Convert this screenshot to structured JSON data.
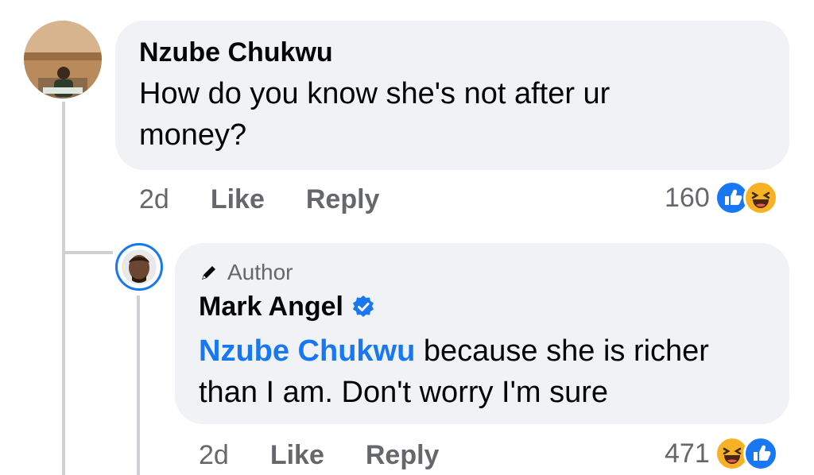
{
  "comment": {
    "author": "Nzube Chukwu",
    "text_line1": "How do you know she's not after ur",
    "text_line2": "money?",
    "time": "2d",
    "like_label": "Like",
    "reply_label": "Reply",
    "reaction_count": "160",
    "reactions": [
      "like-icon",
      "haha-icon"
    ]
  },
  "reply": {
    "badge": "Author",
    "author": "Mark Angel",
    "verified": true,
    "mention": "Nzube Chukwu",
    "text_line1_rest": " because she is richer",
    "text_line2": "than I am. Don't worry I'm sure",
    "time": "2d",
    "like_label": "Like",
    "reply_label": "Reply",
    "reaction_count": "471",
    "reactions": [
      "haha-icon",
      "like-icon"
    ]
  },
  "colors": {
    "accent": "#1877f2",
    "bubble": "#f0f2f5",
    "secondary_text": "#65676b",
    "haha": "#f7b125"
  }
}
